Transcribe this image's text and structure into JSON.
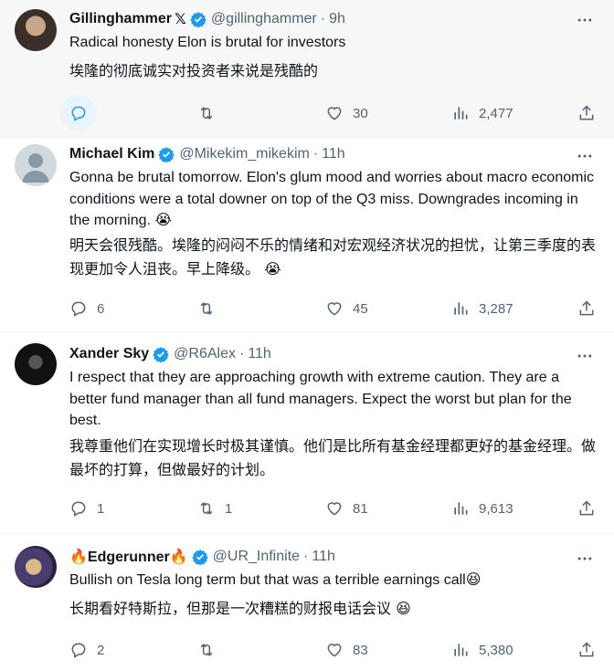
{
  "tweets": [
    {
      "name": "Gillinghammer",
      "x_mark": "𝕏",
      "handle": "@gillinghammer",
      "time": "9h",
      "text": "Radical honesty Elon is brutal for investors",
      "translation": "埃隆的彻底诚实对投资者来说是残酷的",
      "replies": "",
      "retweets": "",
      "likes": "30",
      "views": "2,477",
      "highlight": true
    },
    {
      "name": "Michael Kim",
      "handle": "@Mikekim_mikekim",
      "time": "11h",
      "text": "Gonna be brutal tomorrow.  Elon's glum mood and worries about macro economic conditions were a total downer on top of the Q3 miss. Downgrades incoming in the morning. 😭",
      "translation": "明天会很残酷。埃隆的闷闷不乐的情绪和对宏观经济状况的担忧，让第三季度的表现更加令人沮丧。早上降级。 😭",
      "replies": "6",
      "retweets": "",
      "likes": "45",
      "views": "3,287"
    },
    {
      "name": "Xander Sky",
      "handle": "@R6Alex",
      "time": "11h",
      "text": "I respect that they are approaching growth with extreme caution. They are a better fund manager than all fund managers. Expect the worst but plan for the best.",
      "translation": "我尊重他们在实现增长时极其谨慎。他们是比所有基金经理都更好的基金经理。做最坏的打算，但做最好的计划。",
      "replies": "1",
      "retweets": "1",
      "likes": "81",
      "views": "9,613"
    },
    {
      "name": "🔥Edgerunner🔥",
      "handle": "@UR_Infinite",
      "time": "11h",
      "text": "Bullish on Tesla long term but that was a terrible earnings call😆",
      "translation": "长期看好特斯拉，但那是一次糟糕的财报电话会议 😆",
      "replies": "2",
      "retweets": "",
      "likes": "83",
      "views": "5,380"
    }
  ],
  "colors": {
    "verified": "#1d9bf0",
    "muted": "#536471",
    "highlight_bg": "#f7f7f7",
    "divider": "#eff3f4"
  }
}
